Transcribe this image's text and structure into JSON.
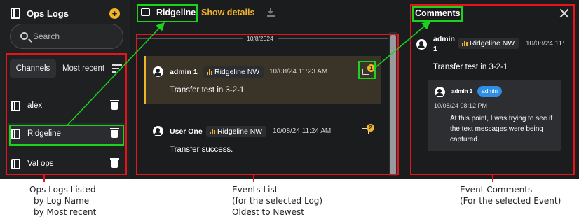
{
  "sidebar": {
    "title": "Ops Logs",
    "add_icon": "plus-circle-icon",
    "search_placeholder": "Search",
    "tabs": [
      {
        "label": "Channels"
      },
      {
        "label": "Most recent"
      }
    ],
    "logs": [
      {
        "label": "alex"
      },
      {
        "label": "Ridgeline"
      },
      {
        "label": "Val ops"
      }
    ]
  },
  "channel": {
    "title": "Ridgeline",
    "show_details": "Show details"
  },
  "events": {
    "date": "10/8/2024",
    "items": [
      {
        "user": "admin 1",
        "chip": "Ridgeline NW",
        "time": "10/08/24 11:23 AM",
        "text": "Transfer test in 3-2-1",
        "comment_count": "1"
      },
      {
        "user": "User One",
        "chip": "Ridgeline NW",
        "time": "10/08/24 11:24 AM",
        "text": "Transfer success.",
        "comment_count": "2"
      }
    ]
  },
  "comments": {
    "title": "Comments",
    "event_user": "admin",
    "event_user_line2": "1",
    "event_chip": "Ridgeline NW",
    "event_time": "10/08/24 11:",
    "event_text": "Transfer test in 3-2-1",
    "reply": {
      "user": "admin 1",
      "role": "admin",
      "time": "10/08/24 08:12 PM",
      "text": "At this point, I was trying to see if the text messages were being captured."
    }
  },
  "captions": {
    "left": [
      "Ops Logs Listed",
      "by Log Name",
      "by Most recent"
    ],
    "middle": [
      "Events List",
      "(for the selected Log)",
      "Oldest to Newest"
    ],
    "right": [
      "Event Comments",
      "(For the selected Event)"
    ]
  },
  "colors": {
    "accent": "#f0b429",
    "annotation_red": "#e8141a",
    "annotation_green": "#19d31c",
    "badge_blue": "#2f8ee5"
  }
}
